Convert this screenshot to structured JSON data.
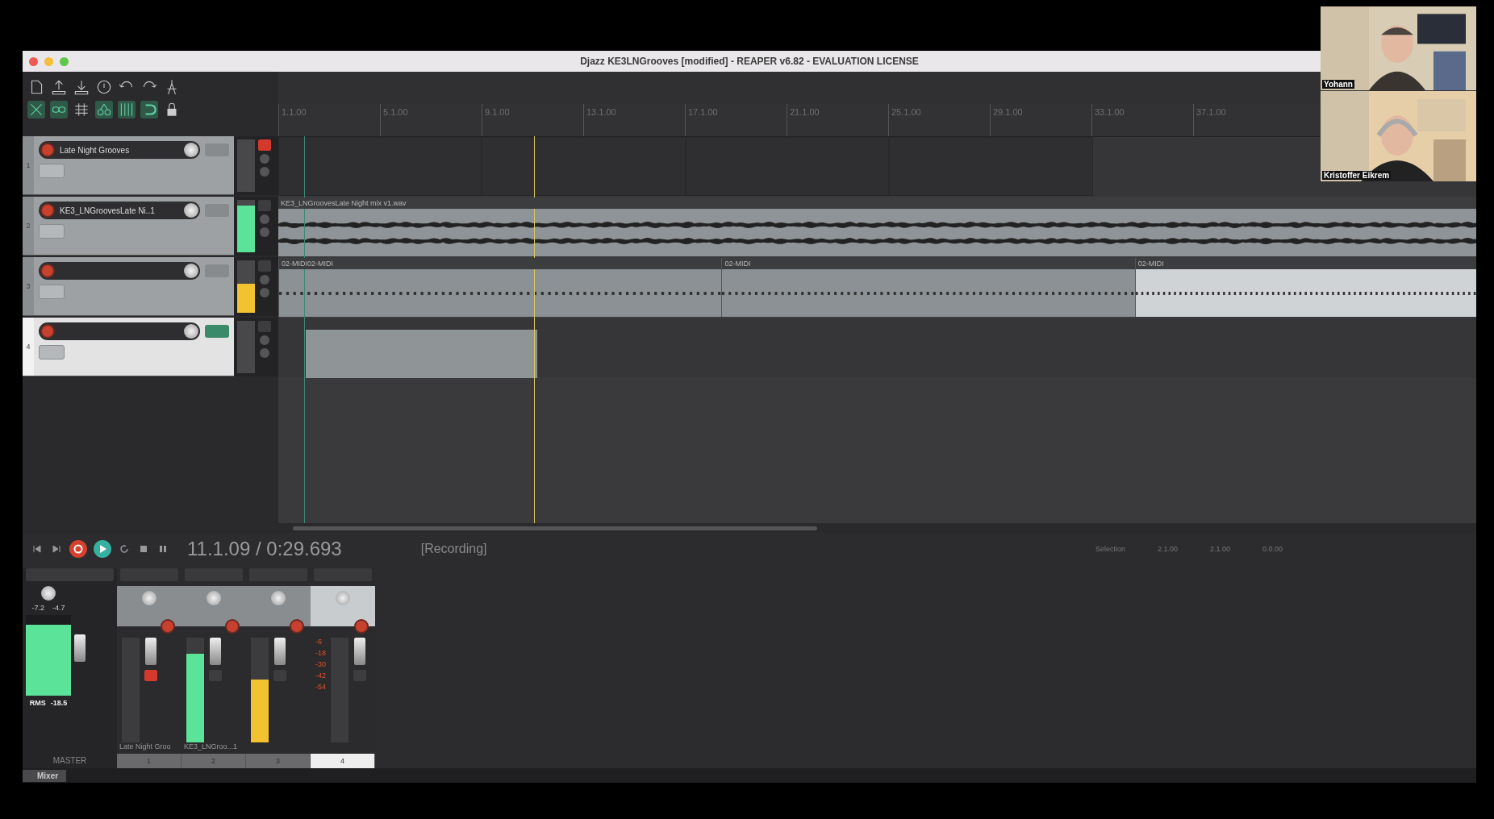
{
  "window": {
    "title": "Djazz KE3LNGrooves [modified] - REAPER v6.82 - EVALUATION LICENSE"
  },
  "video_tiles": [
    {
      "name": "Yohann"
    },
    {
      "name": "Kristoffer Eikrem"
    }
  ],
  "ruler": [
    "1.1.00",
    "5.1.00",
    "9.1.00",
    "13.1.00",
    "17.1.00",
    "21.1.00",
    "25.1.00",
    "29.1.00",
    "33.1.00",
    "37.1.00"
  ],
  "tracks": [
    {
      "number": "1",
      "name": "Late Night Grooves",
      "selected": false,
      "muted": true,
      "items": [
        {
          "kind": "region"
        },
        {
          "kind": "region"
        },
        {
          "kind": "region"
        },
        {
          "kind": "region"
        }
      ]
    },
    {
      "number": "2",
      "name": "KE3_LNGroovesLate Ni..1",
      "selected": false,
      "muted": false,
      "level": 0.9,
      "color": "#5be39a",
      "items": [
        {
          "kind": "audio",
          "label": "KE3_LNGroovesLate Night  mix v1.wav"
        }
      ]
    },
    {
      "number": "3",
      "selected": false,
      "muted": false,
      "level": 0.55,
      "color": "#f2c230",
      "items": [
        {
          "kind": "midi",
          "label": "02-MIDI02-MIDI",
          "selected": false
        },
        {
          "kind": "midi",
          "label": "02-MIDI",
          "selected": false
        },
        {
          "kind": "midi",
          "label": "02-MIDI",
          "selected": true
        }
      ]
    },
    {
      "number": "4",
      "selected": true,
      "muted": false,
      "items": [
        {
          "kind": "blank"
        }
      ]
    }
  ],
  "transport": {
    "position": "11.1.09 / 0:29.693",
    "status": "[Recording]",
    "recording": true,
    "playing": true,
    "selection_label": "Selection",
    "selection": [
      "2.1.00",
      "2.1.00",
      "0.0.00"
    ]
  },
  "mixer": {
    "master": {
      "label": "MASTER",
      "peaks": [
        "-7.2",
        "-4.7"
      ],
      "rms_label": "RMS",
      "rms": "-18.5",
      "level": 0.88
    },
    "strips": [
      {
        "number": "1",
        "name": "Late Night Groo",
        "selected": false,
        "muted": true
      },
      {
        "number": "2",
        "name": "KE3_LNGroo...1",
        "selected": false,
        "muted": false,
        "level": 0.85,
        "color": "#5be39a"
      },
      {
        "number": "3",
        "selected": false,
        "muted": false,
        "level": 0.6,
        "color": "#f2c230"
      },
      {
        "number": "4",
        "selected": true,
        "muted": false,
        "scale": [
          "-6",
          "-18",
          "-30",
          "-42",
          "-54"
        ]
      }
    ],
    "tab": "Mixer"
  }
}
